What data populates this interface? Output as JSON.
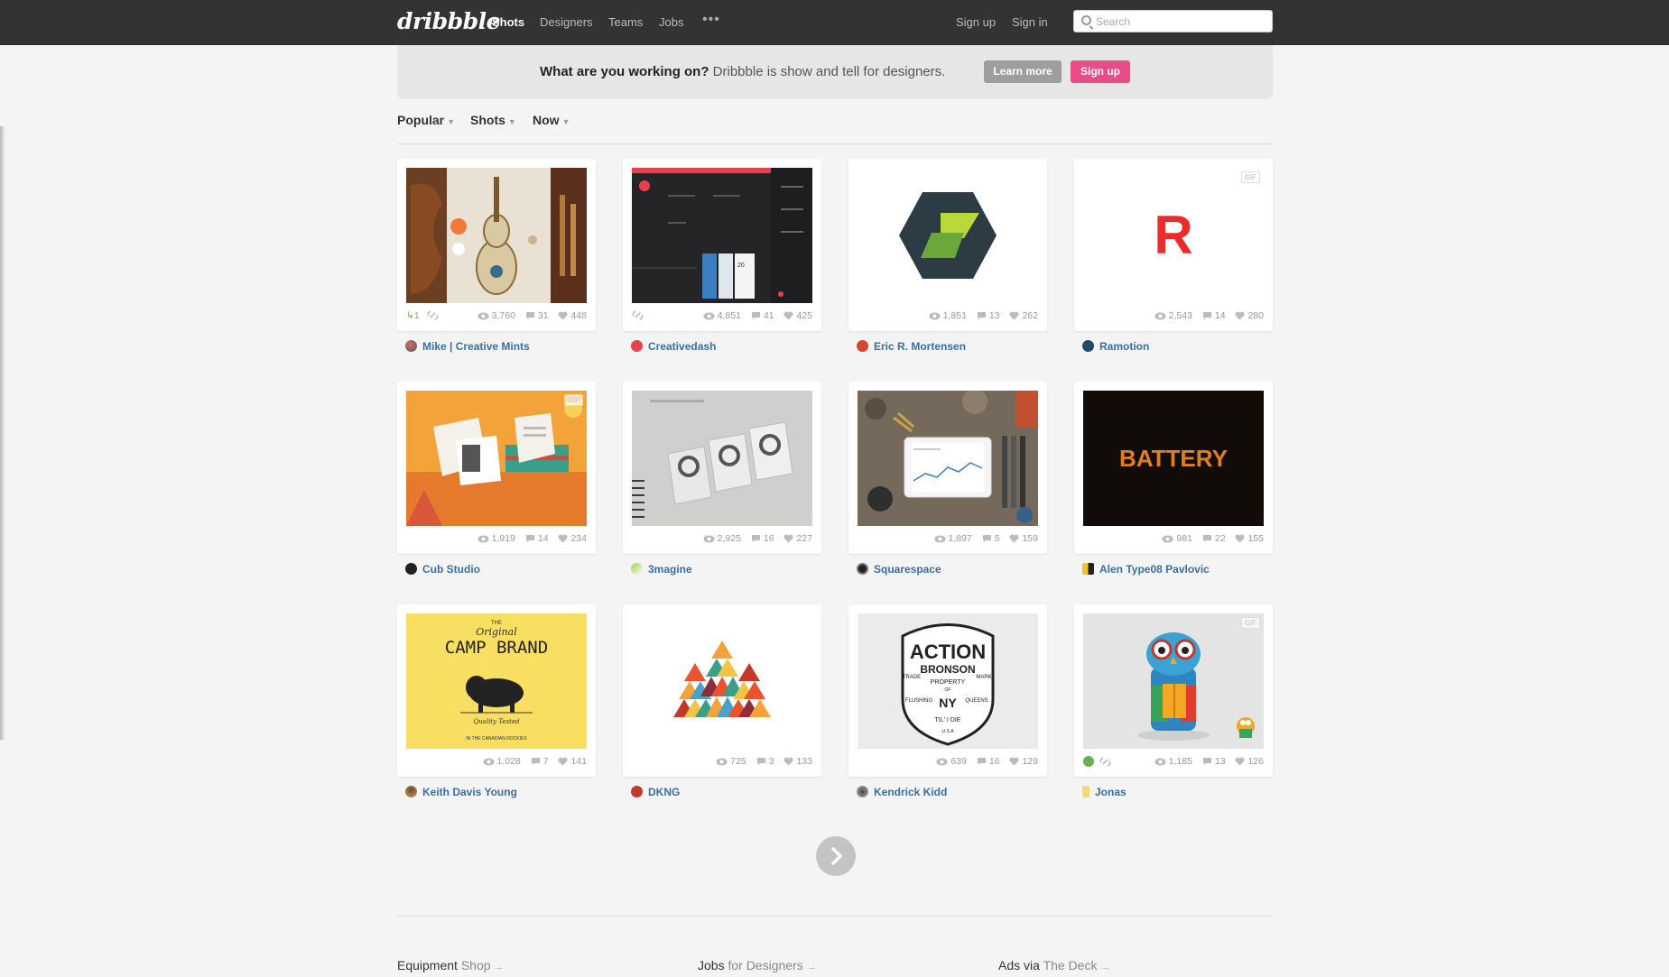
{
  "topbar": {
    "logo": "dribbble",
    "nav": [
      "Shots",
      "Designers",
      "Teams",
      "Jobs"
    ],
    "more_dots": "•••",
    "signup": "Sign up",
    "signin": "Sign in",
    "search_placeholder": "Search"
  },
  "promo": {
    "question": "What are you working on?",
    "tagline": " Dribbble is show and tell for designers.",
    "learn_more": "Learn more",
    "sign_up": "Sign up"
  },
  "filters": [
    "Popular",
    "Shots",
    "Now"
  ],
  "shots": [
    {
      "views": "3,760",
      "comments": "31",
      "likes": "448",
      "author": "Mike | Creative Mints",
      "rebounds": "1"
    },
    {
      "views": "4,851",
      "comments": "41",
      "likes": "425",
      "author": "Creativedash"
    },
    {
      "views": "1,851",
      "comments": "13",
      "likes": "262",
      "author": "Eric R. Mortensen"
    },
    {
      "views": "2,543",
      "comments": "14",
      "likes": "280",
      "author": "Ramotion"
    },
    {
      "views": "1,919",
      "comments": "14",
      "likes": "234",
      "author": "Cub Studio"
    },
    {
      "views": "2,925",
      "comments": "16",
      "likes": "227",
      "author": "3magine"
    },
    {
      "views": "1,897",
      "comments": "5",
      "likes": "159",
      "author": "Squarespace"
    },
    {
      "views": "981",
      "comments": "22",
      "likes": "155",
      "author": "Alen Type08 Pavlovic"
    },
    {
      "views": "1,028",
      "comments": "7",
      "likes": "141",
      "author": "Keith Davis Young"
    },
    {
      "views": "725",
      "comments": "3",
      "likes": "133",
      "author": "DKNG"
    },
    {
      "views": "639",
      "comments": "16",
      "likes": "129",
      "author": "Kendrick Kidd"
    },
    {
      "views": "1,185",
      "comments": "13",
      "likes": "126",
      "author": "Jonas"
    }
  ],
  "artwork": {
    "ramotion_letter": "R",
    "battery_text": "BATTERY",
    "camp_brand": {
      "small": "THE",
      "script": "Original",
      "title": "CAMP BRAND",
      "sub": "Quality Tested",
      "tag": "IN THE CANADIAN ROCKIES"
    },
    "action_bronson": {
      "title": "ACTION",
      "name": "BRONSON",
      "left": "TRADE",
      "right": "MARK",
      "property": "PROPERTY",
      "of": "OF",
      "flushing": "FLUSHING",
      "queens": "QUEENS",
      "til": "TIL' I DIE",
      "usa": "U.S.A",
      "initials": "NY"
    },
    "gif_label": "GIF",
    "dashboard_number": "20"
  },
  "footer": [
    {
      "title": "Equipment",
      "sub": "Shop",
      "arrow": "→"
    },
    {
      "title": "Jobs",
      "sub": "for Designers",
      "arrow": "→"
    },
    {
      "title": "Ads",
      "via": "via",
      "sub": "The Deck",
      "arrow": "→"
    }
  ],
  "colors": {
    "topbar": "#333333",
    "accent_pink": "#ea4c89",
    "link_blue": "#3a6ea5",
    "page_bg": "#f4f4f4"
  }
}
